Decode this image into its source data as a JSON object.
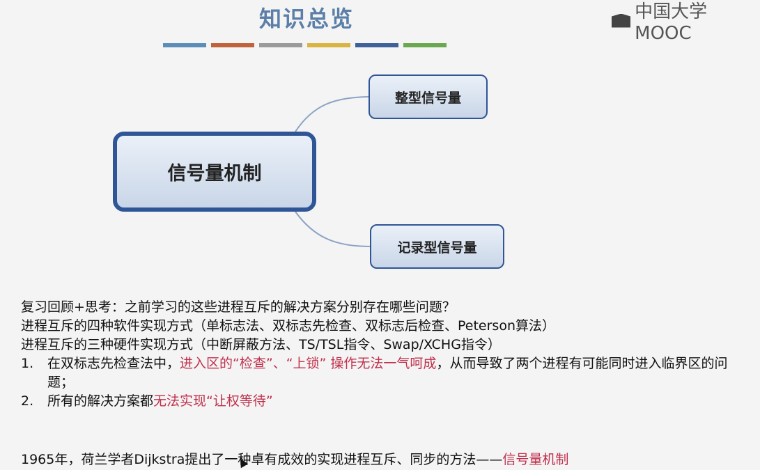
{
  "slide": {
    "title": "知识总览",
    "watermark": "中国大学MOOC",
    "color_bars": [
      "#5b8db8",
      "#c0623a",
      "#9a9a9a",
      "#d9b440",
      "#3e5f9a",
      "#6aa84f"
    ]
  },
  "mindmap": {
    "center": "信号量机制",
    "top_branch": "整型信号量",
    "bottom_branch": "记录型信号量"
  },
  "content": {
    "line1": "复习回顾+思考：之前学习的这些进程互斥的解决方案分别存在哪些问题？",
    "line2": "进程互斥的四种软件实现方式（单标志法、双标志先检查、双标志后检查、Peterson算法）",
    "line3": "进程互斥的三种硬件实现方式（中断屏蔽方法、TS/TSL指令、Swap/XCHG指令）",
    "item1": {
      "num": "1.",
      "pre": "在双标志先检查法中，",
      "highlight": "进入区的“检查”、“上锁” 操作无法一气呵成",
      "post": "，从而导致了两个进程有可能同时进入临界区的问题；"
    },
    "item2": {
      "num": "2.",
      "pre": "所有的解决方案都",
      "highlight": "无法实现“让权等待”"
    },
    "final": {
      "pre": "1965年，荷兰学者Dijkstra提出了一种卓有成效的实现进程互斥、同步的方法——",
      "highlight": "信号量机制"
    }
  }
}
